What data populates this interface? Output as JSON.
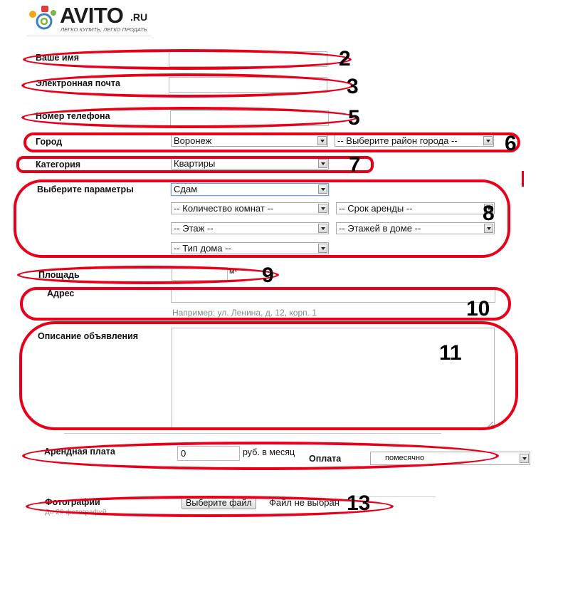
{
  "logo": {
    "brand": "AVITO",
    "suffix": ".RU",
    "tagline": "ЛЕГКО КУПИТЬ, ЛЕГКО ПРОДАТЬ"
  },
  "form": {
    "name_label": "Ваше имя",
    "email_label": "Электронная почта",
    "phone_label": "Номер телефона",
    "city_label": "Город",
    "city_value": "Воронеж",
    "district_value": "-- Выберите район города --",
    "category_label": "Категория",
    "category_value": "Квартиры",
    "params_label": "Выберите параметры",
    "params": {
      "deal": "Сдам",
      "rooms": "-- Количество комнат --",
      "term": "-- Срок аренды --",
      "floor": "-- Этаж --",
      "floors_total": "-- Этажей в доме --",
      "house_type": "-- Тип дома --"
    },
    "area_label": "Площадь",
    "area_unit": "м²",
    "address_label": "Адрес",
    "address_hint": "Например: ул. Ленина, д. 12, корп. 1",
    "description_label": "Описание объявления",
    "rent_label": "Арендная плата",
    "rent_value": "0",
    "rent_unit": "руб. в месяц",
    "payment_label": "Оплата",
    "payment_value": "помесячно",
    "photos_label": "Фотографии",
    "photos_hint": "До 20 фотографий",
    "file_button": "Выберите файл",
    "file_status": "Файл не выбран"
  },
  "annotations": [
    "2",
    "3",
    "5",
    "6",
    "7",
    "8",
    "9",
    "10",
    "11",
    "13"
  ],
  "colors": {
    "annotation": "#e8001b",
    "link": "#1a4f9c"
  }
}
